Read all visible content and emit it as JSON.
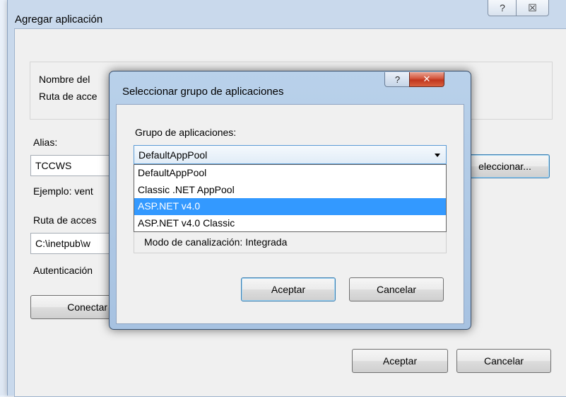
{
  "window": {
    "title": "Agregar aplicación",
    "help_glyph": "?",
    "close_glyph": "☒"
  },
  "main": {
    "site_name_label": "Nombre del",
    "path_label": "Ruta de acce",
    "alias_label": "Alias:",
    "alias_value": "TCCWS",
    "example_label": "Ejemplo: vent",
    "physical_path_label": "Ruta de acces",
    "physical_path_value": "C:\\inetpub\\w",
    "auth_label": "Autenticación",
    "connect_button": "Conectar co",
    "select_button": "eleccionar...",
    "ok_button": "Aceptar",
    "cancel_button": "Cancelar"
  },
  "modal": {
    "title": "Seleccionar grupo de aplicaciones",
    "help_glyph": "?",
    "close_glyph": "✕",
    "group_label": "Grupo de aplicaciones:",
    "selected_value": "DefaultAppPool",
    "options": [
      "DefaultAppPool",
      "Classic .NET AppPool",
      "ASP.NET v4.0",
      "ASP.NET v4.0 Classic"
    ],
    "highlighted_option": "ASP.NET v4.0",
    "pipeline_text": "Modo de canalización: Integrada",
    "ok_button": "Aceptar",
    "cancel_button": "Cancelar"
  }
}
